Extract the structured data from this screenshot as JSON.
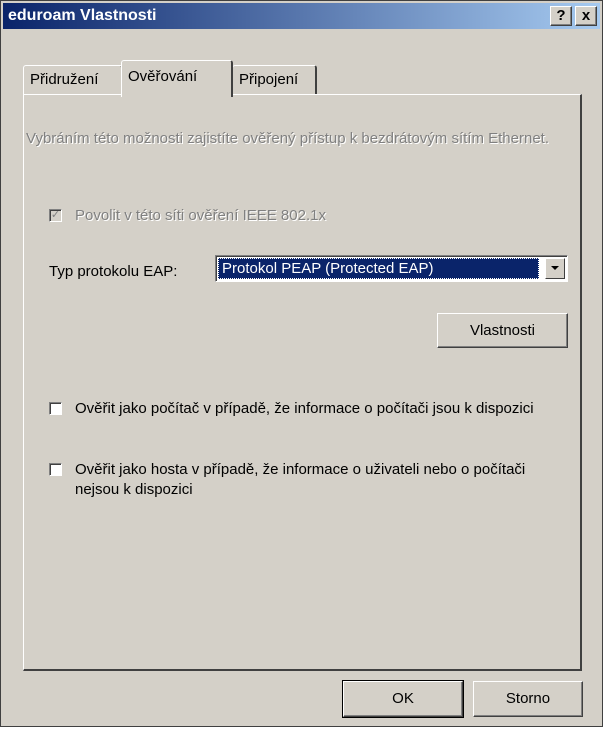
{
  "window": {
    "title": "eduroam Vlastnosti",
    "help_label": "?",
    "close_label": "x"
  },
  "tabs": [
    {
      "label": "Přidružení",
      "active": false
    },
    {
      "label": "Ověřování",
      "active": true
    },
    {
      "label": "Připojení",
      "active": false
    }
  ],
  "auth": {
    "description": "Vybráním této možnosti zajistíte ověřený přístup k bezdrátovým sítím Ethernet.",
    "ieee_checkbox": {
      "label": "Povolit v této síti ověření IEEE 802.1x",
      "checked": true,
      "enabled": false
    },
    "eap_label": "Typ protokolu EAP:",
    "eap_selected": "Protokol PEAP (Protected EAP)",
    "properties_button": "Vlastnosti",
    "computer_checkbox": {
      "label": "Ověřit jako počítač v případě, že informace o počítači jsou k dispozici",
      "checked": false
    },
    "host_checkbox": {
      "label": "Ověřit jako hosta v případě, že informace o uživateli nebo o počítači nejsou k dispozici",
      "checked": false
    }
  },
  "footer": {
    "ok_label": "OK",
    "cancel_label": "Storno"
  },
  "colors": {
    "titlebar_start": "#0a246a",
    "titlebar_end": "#a6caf0",
    "face": "#d4d0c8",
    "selection": "#0a246a"
  }
}
